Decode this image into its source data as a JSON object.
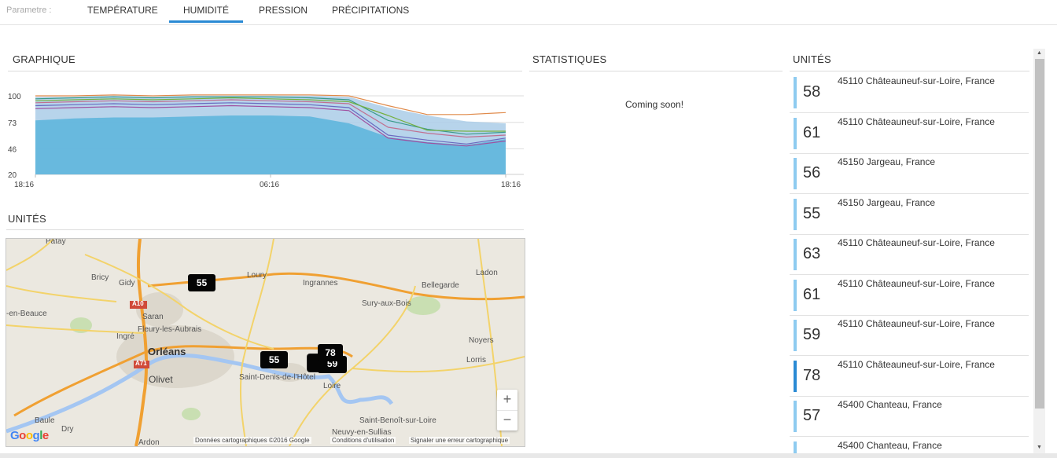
{
  "topbar": {
    "param_label": "Parametre :",
    "tabs": [
      "TEMPÉRATURE",
      "HUMIDITÉ",
      "PRESSION",
      "PRÉCIPITATIONS"
    ],
    "active_tab": "HUMIDITÉ"
  },
  "sections": {
    "graph_title": "GRAPHIQUE",
    "stats_title": "STATISTIQUES",
    "stats_text": "Coming soon!",
    "units_title": "UNITÉS",
    "map_title": "UNITÉS"
  },
  "colors": {
    "accent": "#2a8ad4",
    "area_fill": "#5ab4dc",
    "unit_bar": "#8ecbf0",
    "unit_bar_active": "#2a8ad4"
  },
  "chart_data": {
    "type": "area",
    "x_ticks": [
      "18:16",
      "06:16",
      "18:16"
    ],
    "y_ticks": [
      100,
      73,
      46,
      20
    ],
    "ylim": [
      20,
      100
    ],
    "x": [
      0,
      1,
      2,
      3,
      4,
      5,
      6,
      7,
      8,
      9,
      10,
      11,
      12
    ],
    "series": [
      {
        "color": "#5ab4dc",
        "values": [
          75,
          77,
          78,
          78,
          79,
          80,
          80,
          79,
          72,
          58,
          53,
          50,
          56
        ],
        "filled": true
      },
      {
        "color": "#e08a4a",
        "values": [
          100,
          100,
          101,
          100,
          101,
          101,
          101,
          101,
          100,
          90,
          81,
          81,
          83
        ]
      },
      {
        "color": "#3a9a8a",
        "values": [
          97,
          98,
          99,
          98,
          99,
          99,
          99,
          98,
          96,
          75,
          66,
          61,
          63
        ]
      },
      {
        "color": "#76b040",
        "values": [
          95,
          96,
          97,
          96,
          97,
          98,
          97,
          96,
          94,
          80,
          65,
          64,
          64
        ]
      },
      {
        "color": "#6a6ac0",
        "values": [
          90,
          91,
          92,
          91,
          92,
          93,
          92,
          91,
          88,
          60,
          55,
          51,
          57
        ]
      },
      {
        "color": "#a050a0",
        "values": [
          87,
          88,
          89,
          88,
          89,
          90,
          89,
          88,
          85,
          57,
          52,
          49,
          54
        ]
      },
      {
        "color": "#c07090",
        "values": [
          93,
          94,
          95,
          94,
          95,
          96,
          95,
          94,
          92,
          68,
          62,
          58,
          60
        ]
      },
      {
        "color": "#aacde8",
        "values": [
          99,
          99,
          100,
          99,
          100,
          100,
          100,
          100,
          99,
          88,
          80,
          74,
          72
        ],
        "filled": true
      }
    ]
  },
  "map": {
    "places": [
      {
        "name": "Patay"
      },
      {
        "name": "Bricy"
      },
      {
        "name": "Gidy"
      },
      {
        "name": "Loury"
      },
      {
        "name": "Ingrannes"
      },
      {
        "name": "Bellegarde"
      },
      {
        "name": "Ladon"
      },
      {
        "name": "-en-Beauce"
      },
      {
        "name": "Saran"
      },
      {
        "name": "Fleury-les-Aubrais"
      },
      {
        "name": "Sury-aux-Bois"
      },
      {
        "name": "Ingré"
      },
      {
        "name": "Orléans",
        "big": true
      },
      {
        "name": "Olivet"
      },
      {
        "name": "Saint-Denis-de-l'Hôtel"
      },
      {
        "name": "Loire"
      },
      {
        "name": "Noyers"
      },
      {
        "name": "Lorris"
      },
      {
        "name": "Baule"
      },
      {
        "name": "Dry"
      },
      {
        "name": "Saint-Benoît-sur-Loire"
      },
      {
        "name": "Neuvy-en-Sullias"
      },
      {
        "name": "Ardon"
      }
    ],
    "road_labels": [
      "A10",
      "A71"
    ],
    "markers": [
      "55",
      "55",
      "78",
      "59"
    ],
    "zoom_in": "+",
    "zoom_out": "−",
    "logo": "Google",
    "footer": {
      "data": "Données cartographiques ©2016 Google",
      "terms": "Conditions d'utilisation",
      "report": "Signaler une erreur cartographique"
    }
  },
  "units": [
    {
      "value": "58",
      "location": "45110 Châteauneuf-sur-Loire, France"
    },
    {
      "value": "61",
      "location": "45110 Châteauneuf-sur-Loire, France"
    },
    {
      "value": "56",
      "location": "45150 Jargeau, France"
    },
    {
      "value": "55",
      "location": "45150 Jargeau, France"
    },
    {
      "value": "63",
      "location": "45110 Châteauneuf-sur-Loire, France"
    },
    {
      "value": "61",
      "location": "45110 Châteauneuf-sur-Loire, France"
    },
    {
      "value": "59",
      "location": "45110 Châteauneuf-sur-Loire, France"
    },
    {
      "value": "78",
      "location": "45110 Châteauneuf-sur-Loire, France",
      "active": true
    },
    {
      "value": "57",
      "location": "45400 Chanteau, France"
    },
    {
      "value": "",
      "location": "45400 Chanteau, France"
    }
  ]
}
